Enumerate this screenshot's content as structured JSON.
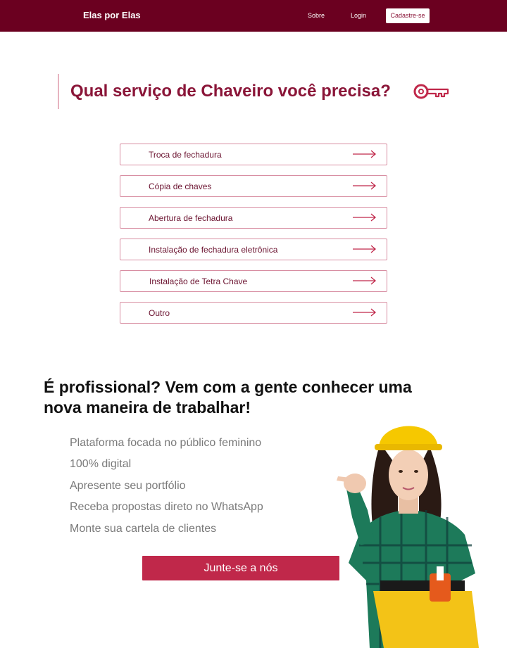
{
  "header": {
    "brand": "Elas por Elas",
    "nav": {
      "about": "Sobre",
      "login": "Login",
      "signup": "Cadastre-se"
    }
  },
  "services": {
    "title": "Qual serviço de Chaveiro você precisa?",
    "items": [
      "Troca de fechadura",
      "Cópia de chaves",
      "Abertura de fechadura",
      "Instalação de fechadura eletrônica",
      "Instalação de Tetra Chave",
      "Outro"
    ]
  },
  "professional": {
    "title_line1": "É profissional? Vem com a gente conhecer uma",
    "title_line2": "nova maneira de trabalhar!",
    "benefits": [
      "Plataforma focada no público feminino",
      "100% digital",
      "Apresente seu portfólio",
      "Receba propostas direto no WhatsApp",
      "Monte sua cartela de clientes"
    ],
    "cta": "Junte-se a nós"
  },
  "colors": {
    "header_bg": "#6b0020",
    "accent": "#8a1538",
    "cta_bg": "#c0284a",
    "border": "#d88ea2"
  },
  "icons": {
    "title_icon": "key-icon",
    "service_icon": "arrow-right-icon"
  }
}
